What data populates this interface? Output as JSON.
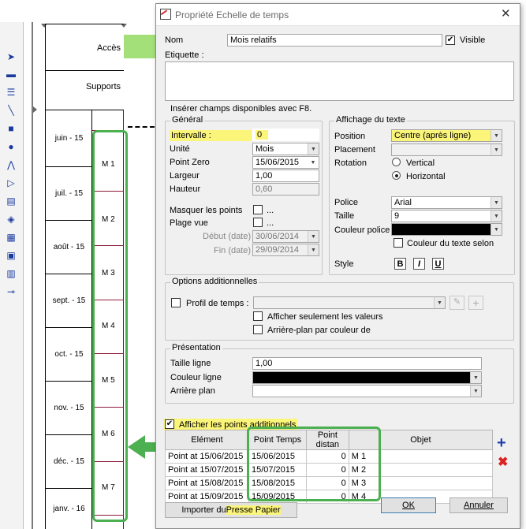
{
  "background": {
    "headers": {
      "acces": "Accès",
      "supports": "Supports"
    },
    "dates": [
      "juin - 15",
      "juil. - 15",
      "août - 15",
      "sept. - 15",
      "oct. - 15",
      "nov. - 15",
      "déc. - 15",
      "janv. - 16"
    ],
    "month_labels": [
      "M 1",
      "M 2",
      "M 3",
      "M 4",
      "M 5",
      "M 6",
      "M 7"
    ],
    "axis_ticks": [
      "2",
      "2",
      "2",
      "2"
    ]
  },
  "dialog": {
    "title": "Propriété Echelle de temps",
    "nom_label": "Nom",
    "nom_value": "Mois relatifs",
    "visible_label": "Visible",
    "visible_checked": true,
    "etiquette_label": "Etiquette :",
    "etiquette_value": "",
    "f8_hint": "Insérer champs disponibles avec F8.",
    "general": {
      "title": "Général",
      "intervalle_label": "Intervalle :",
      "intervalle_value": "0",
      "unite_label": "Unité",
      "unite_value": "Mois",
      "point_zero_label": "Point Zero",
      "point_zero_value": "15/06/2015",
      "largeur_label": "Largeur",
      "largeur_value": "1,00",
      "hauteur_label": "Hauteur",
      "hauteur_value": "0,60",
      "masquer_label": "Masquer les points",
      "plage_label": "Plage vue",
      "ellipsis": "...",
      "debut_label": "Début (date)",
      "debut_value": "30/06/2014",
      "fin_label": "Fin (date)",
      "fin_value": "29/09/2014"
    },
    "affichage": {
      "title": "Affichage du texte",
      "position_label": "Position",
      "position_value": "Centre (après ligne)",
      "placement_label": "Placement",
      "placement_value": "",
      "rotation_label": "Rotation",
      "vertical_label": "Vertical",
      "horizontal_label": "Horizontal",
      "police_label": "Police",
      "police_value": "Arial",
      "taille_label": "Taille",
      "taille_value": "9",
      "couleur_police_label": "Couleur police",
      "couleur_selon_label": "Couleur du texte selon",
      "style_label": "Style",
      "bold": "B",
      "italic": "I",
      "underline": "U"
    },
    "options": {
      "title": "Options additionnelles",
      "profil_label": "Profil de temps :",
      "afficher_valeurs_label": "Afficher seulement les valeurs",
      "arriere_plan_couleur_label": "Arrière-plan par couleur de"
    },
    "presentation": {
      "title": "Présentation",
      "taille_ligne_label": "Taille ligne",
      "taille_ligne_value": "1,00",
      "couleur_ligne_label": "Couleur ligne",
      "arriere_plan_label": "Arrière plan"
    },
    "points": {
      "afficher_label": "Afficher les points additionnels",
      "checked": true,
      "columns": [
        "Elément",
        "Point Temps",
        "Point distan",
        "Objet"
      ],
      "rows": [
        {
          "element": "Point at 15/06/2015",
          "point_temps": "15/06/2015",
          "distance": "0",
          "objet": "M 1"
        },
        {
          "element": "Point at 15/07/2015",
          "point_temps": "15/07/2015",
          "distance": "0",
          "objet": "M 2"
        },
        {
          "element": "Point at 15/08/2015",
          "point_temps": "15/08/2015",
          "distance": "0",
          "objet": "M 3"
        },
        {
          "element": "Point at 15/09/2015",
          "point_temps": "15/09/2015",
          "distance": "0",
          "objet": "M 4"
        }
      ]
    },
    "import_label_prefix": "Importer du ",
    "import_label_highlight": "Presse Papier",
    "ok_label": "OK",
    "cancel_label": "Annuler"
  },
  "colors": {
    "highlight": "#fbf57a",
    "annotation_green": "#4caf50",
    "month_line": "#8c1a3a",
    "header_green": "#a3e07a"
  }
}
